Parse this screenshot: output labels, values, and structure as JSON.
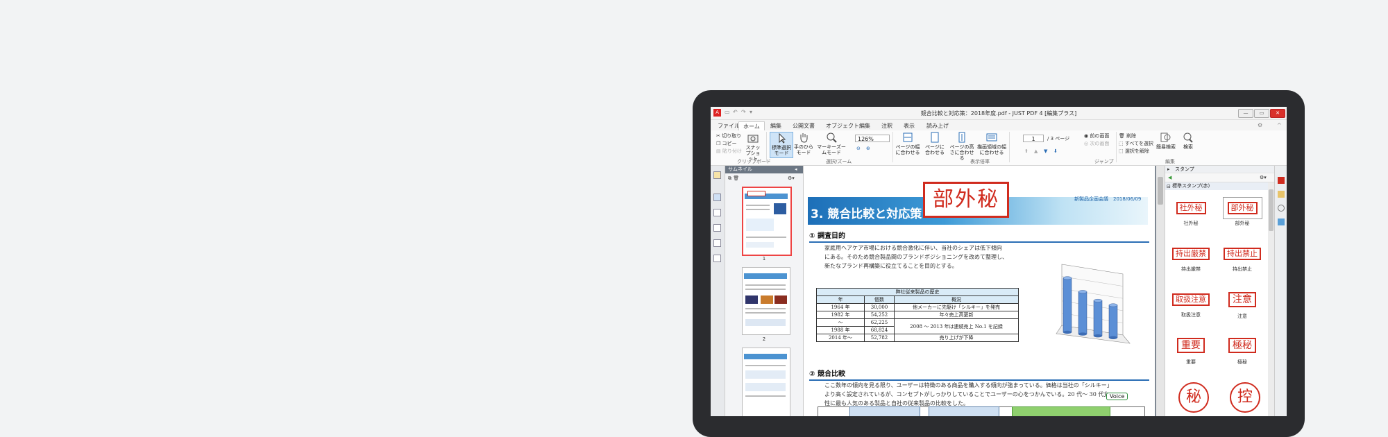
{
  "window": {
    "title": "競合比較と対応策：2018年度.pdf - JUST PDF 4 [編集プラス]",
    "icon_name": "app-pdf-icon"
  },
  "tabs": [
    "ファイル",
    "ホーム",
    "編集",
    "公開文書",
    "オブジェクト編集",
    "注釈",
    "表示",
    "読み上げ"
  ],
  "ribbon": {
    "clipboard": {
      "cut": "切り取り",
      "copy": "コピー",
      "paste": "貼り付け",
      "snapshot": "スナップショット",
      "group": "クリップボード"
    },
    "select_zoom": {
      "select_mode": "標準選択モード",
      "hand_mode": "手のひらモード",
      "marquee_zoom": "マーキーズームモード",
      "zoom_value": "126%",
      "group": "選択/ズーム"
    },
    "display_size": {
      "fit_width": "ページの幅に合わせる",
      "fit_page": "ページに合わせる",
      "fit_height": "ページの高さに合わせる",
      "fit_visible": "描画領域の幅に合わせる",
      "group": "表示倍率"
    },
    "jump": {
      "page_current": "1",
      "page_total": "/ 3 ページ",
      "prev_view": "前の画面",
      "next_view": "次の画面",
      "group": "ジャンプ"
    },
    "edit": {
      "delete": "削除",
      "select_all": "すべてを選択",
      "deselect": "選択を解除",
      "simple_search": "簡易検索",
      "search": "検索",
      "group": "編集"
    }
  },
  "thumbnail_panel": {
    "title": "サムネイル",
    "pages": [
      "1",
      "2"
    ]
  },
  "document": {
    "stamp_text": "部外秘",
    "meta": "新製品企画会議　2018/06/09",
    "title": "3. 競合比較と対応策",
    "section1": "①  調査目的",
    "para1": [
      "家庭用ヘアケア市場における競合激化に伴い、当社のシェアは低下傾向",
      "にある。そのため競合製品間のブランドポジショニングを改めて整理し、",
      "新たなブランド再構築に役立てることを目的とする。"
    ],
    "table": {
      "caption": "弊社従来製品の歴史",
      "headers": [
        "年",
        "個数",
        "概況"
      ],
      "rows": [
        [
          "1964 年",
          "30,000",
          "他メーカーに先駆け「シルキー」を発売"
        ],
        [
          "1982 年",
          "54,252",
          "年々売上高更新"
        ],
        [
          "〜",
          "62,225",
          "2008 〜 2013 年は連続売上 No.1 を記録"
        ],
        [
          "1988 年",
          "68,824",
          ""
        ],
        [
          "2014 年〜",
          "52,782",
          "売り上げが下降"
        ]
      ]
    },
    "section2": "②  競合比較",
    "para2": [
      "ここ数年の傾向を見る限り、ユーザーは特徴のある商品を購入する傾向が強まっている。価格は当社の「シルキー」",
      "より高く設定されているが、コンセプトがしっかりしていることでユーザーの心をつかんでいる。20 代〜 30 代女",
      "性に最も人気のある製品と自社の従来製品の比較をした。"
    ],
    "voice_label": "Voice"
  },
  "chart_data": {
    "type": "bar",
    "title": "",
    "categories": [
      "",
      "",
      "",
      ""
    ],
    "values": [
      100,
      78,
      65,
      60
    ],
    "ylim": [
      0,
      110
    ],
    "colors": {
      "bar": "#5b8fd6"
    }
  },
  "stamp_panel": {
    "title": "スタンプ",
    "category": "標準スタンプ(赤)",
    "stamps": [
      {
        "text": "社外秘",
        "label": "社外秘"
      },
      {
        "text": "部外秘",
        "label": "部外秘"
      },
      {
        "text": "持出厳禁",
        "label": "持出厳禁"
      },
      {
        "text": "持出禁止",
        "label": "持出禁止"
      },
      {
        "text": "取扱注意",
        "label": "取扱注意"
      },
      {
        "text": "注意",
        "label": "注意"
      },
      {
        "text": "重要",
        "label": "重要"
      },
      {
        "text": "極秘",
        "label": "極秘"
      },
      {
        "text": "秘",
        "label": ""
      },
      {
        "text": "控",
        "label": ""
      }
    ]
  },
  "colors": {
    "accent": "#2a6db5",
    "stamp_red": "#d02b1e",
    "bezel": "#2b2c2f"
  }
}
